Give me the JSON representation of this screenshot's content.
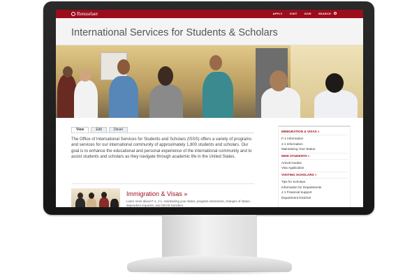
{
  "brand": {
    "logo_text": "Rensselaer"
  },
  "top_nav": {
    "items": [
      "APPLY",
      "VISIT",
      "GIVE",
      "SEARCH"
    ]
  },
  "page": {
    "title": "International Services for Students & Scholars"
  },
  "tabs": [
    {
      "label": "View",
      "active": true
    },
    {
      "label": "Edit",
      "active": false
    },
    {
      "label": "Devel",
      "active": false
    }
  ],
  "intro": "The Office of International Services for Students and Scholars (ISSS) offers a variety of programs and services for our international community of approximately 1,800 students and scholars. Our goal is to enhance the educational and personal experience of the international community and to assist students and scholars as they navigate through academic life in the United States.",
  "immigration": {
    "heading": "Immigration & Visas »",
    "description": "Learn more about F-1, J-1, maintaining your status, program extensions, changes of status, dependent requests, and SEVIS transfers."
  },
  "sidebar": {
    "sections": [
      {
        "heading": "IMMIGRATION & VISAS »",
        "items": [
          "F-1 Information",
          "J-1 Information",
          "Maintaining Your Status"
        ]
      },
      {
        "heading": "NEW STUDENTS »",
        "items": [
          "Arrival Guides",
          "Visa Application"
        ]
      },
      {
        "heading": "VISITING SCHOLARS »",
        "items": [
          "Tips for Scholars",
          "Information for Departments",
          "J-1 Financial Support",
          "Department DS2019"
        ]
      }
    ]
  },
  "colors": {
    "brand_red": "#9c0d1c",
    "monitor_bezel": "#1e1e1e",
    "header_bg": "#f4f4f4"
  }
}
